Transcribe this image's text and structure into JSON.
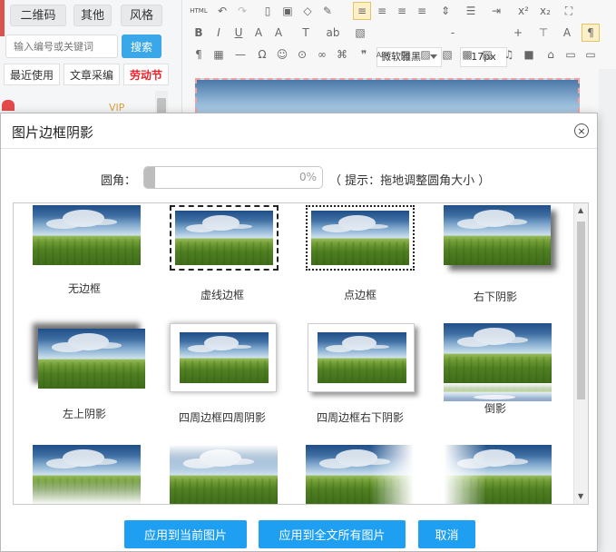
{
  "left_panel": {
    "category_tabs": [
      "二维码",
      "其他",
      "风格"
    ],
    "search": {
      "placeholder": "输入编号或关键词",
      "button": "搜索"
    },
    "sub_tabs": [
      "最近使用",
      "文章采编",
      "劳动节"
    ],
    "vip": "VIP"
  },
  "toolbar": {
    "html_label": "HTML",
    "font_family": "微软雅黑",
    "font_size": "17px",
    "minus": "-",
    "plus": "+"
  },
  "dialog": {
    "title": "图片边框阴影",
    "close_glyph": "×",
    "radius_label": "圆角：",
    "radius_value": "0%",
    "radius_hint": "（ 提示：拖地调整圆角大小 ）",
    "options": [
      {
        "label": "无边框"
      },
      {
        "label": "虚线边框"
      },
      {
        "label": "点边框"
      },
      {
        "label": "右下阴影"
      },
      {
        "label": "左上阴影"
      },
      {
        "label": "四周边框四周阴影"
      },
      {
        "label": "四周边框右下阴影"
      },
      {
        "label": "倒影"
      },
      {
        "label": ""
      },
      {
        "label": ""
      },
      {
        "label": ""
      },
      {
        "label": ""
      }
    ],
    "buttons": {
      "apply_current": "应用到当前图片",
      "apply_all": "应用到全文所有图片",
      "cancel": "取消"
    }
  },
  "colors": {
    "primary": "#1e9ff2",
    "festival_tab": "#e8242a"
  }
}
